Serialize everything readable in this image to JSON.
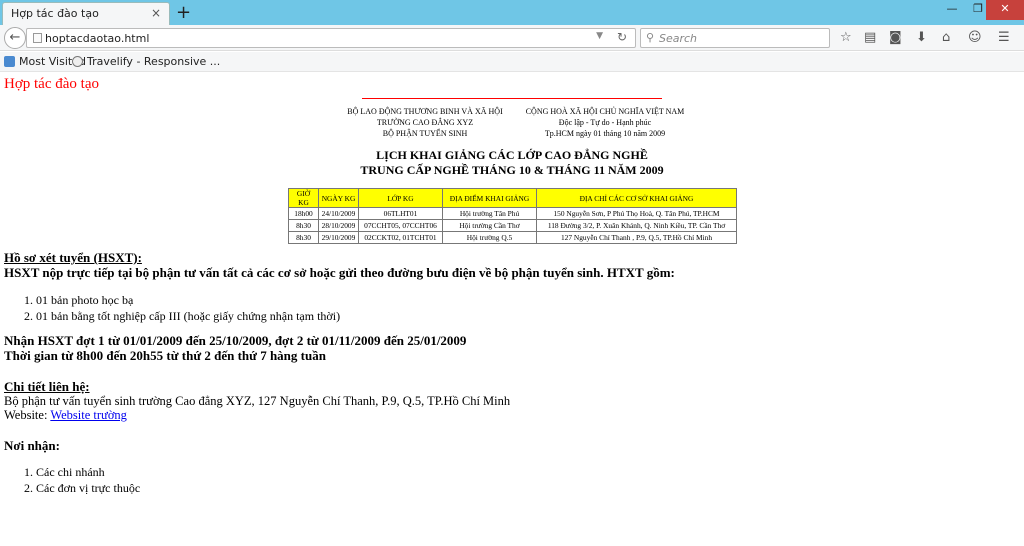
{
  "browser": {
    "tab_title": "Hợp tác đào tạo",
    "tab_close": "×",
    "new_tab": "+",
    "url": "hoptacdaotao.html",
    "search_placeholder": "Search",
    "bookmarks": [
      {
        "label": "Most Visited",
        "icon": "bookmark-folder-icon"
      },
      {
        "label": "Travelify - Responsive ...",
        "icon": "wordpress-icon"
      }
    ],
    "window_buttons": {
      "minimize": "—",
      "maximize": "❐",
      "close": "✕"
    }
  },
  "page": {
    "site_title": "Hợp tác đào tạo",
    "header_left": [
      "BỘ LAO ĐỘNG THƯƠNG BINH VÀ XÃ HỘI",
      "TRƯỜNG CAO ĐẲNG XYZ",
      "BỘ PHẬN TUYỂN SINH"
    ],
    "header_right": [
      "CỘNG HOÀ XÃ HỘI CHỦ NGHĨA VIỆT NAM",
      "Độc lập - Tự do - Hạnh phúc",
      "Tp.HCM ngày 01 tháng 10 năm 2009"
    ],
    "title_line1": "LỊCH KHAI GIẢNG CÁC LỚP CAO ĐẲNG NGHỀ",
    "title_line2": "TRUNG CẤP NGHỀ THÁNG 10 & THÁNG 11 NĂM 2009",
    "table": {
      "headers": [
        "GIỜ KG",
        "NGÀY KG",
        "LỚP KG",
        "ĐỊA ĐIỂM KHAI GIẢNG",
        "ĐỊA CHỈ CÁC CƠ SỞ KHAI GIẢNG"
      ],
      "rows": [
        [
          "18h00",
          "24/10/2009",
          "06TLHT01",
          "Hội trường Tân Phú",
          "150 Nguyễn Sơn, P Phú Thọ Hoà, Q. Tân Phú, TP.HCM"
        ],
        [
          "8h30",
          "28/10/2009",
          "07CCHT05, 07CCHT06",
          "Hội trường Cần Thơ",
          "118 Đường 3/2, P. Xuân Khánh, Q. Ninh Kiều, TP. Cần Thơ"
        ],
        [
          "8h30",
          "29/10/2009",
          "02CCKT02, 01TCHT01",
          "Hội trường Q.5",
          "127 Nguyễn Chí Thanh , P.9, Q.5, TP.Hồ Chí Minh"
        ]
      ]
    },
    "hsxt_heading": "Hồ sơ xét tuyển (HSXT):",
    "hsxt_text": "HSXT nộp trực tiếp tại bộ phận tư vấn tất cả các cơ sở hoặc gửi theo đường bưu điện về bộ phận tuyển sinh. HTXT gồm:",
    "hsxt_items": [
      "1. 01 bản photo học bạ",
      "2. 01 bản bằng tốt nghiệp cấp III (hoặc giấy chứng nhận tạm thời)"
    ],
    "receive_line1": "Nhận HSXT đợt 1 từ 01/01/2009 đến 25/10/2009, đợt 2 từ 01/11/2009 đến 25/01/2009",
    "receive_line2": "Thời gian từ 8h00 đến 20h55 từ thứ 2 đến thứ 7 hàng tuần",
    "contact_heading": "Chi tiết liên hệ:",
    "contact_text": "Bộ phận tư vấn tuyển sinh trường Cao đẳng XYZ, 127 Nguyễn Chí Thanh, P.9, Q.5, TP.Hồ Chí Minh",
    "website_label": "Website: ",
    "website_link": "Website trường",
    "recipients_heading": "Nơi nhận:",
    "recipients": [
      "1. Các chi nhánh",
      "2. Các đơn vị trực thuộc"
    ]
  }
}
